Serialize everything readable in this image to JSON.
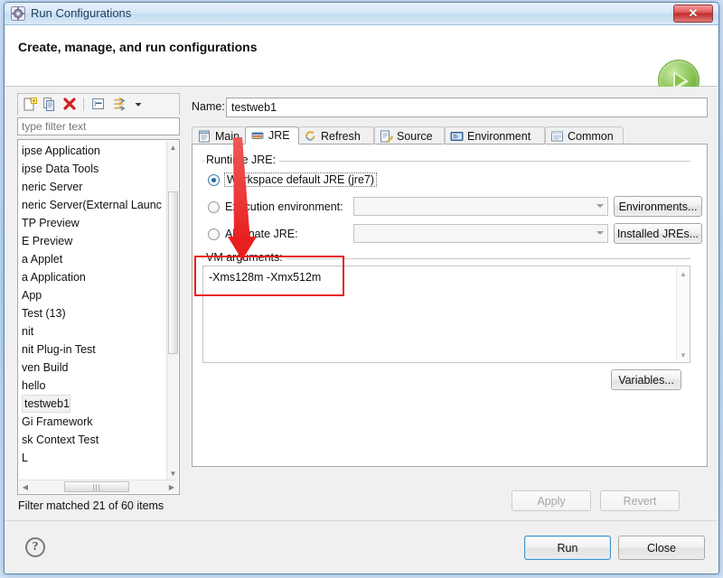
{
  "window": {
    "title": "Run Configurations",
    "title_icon": "run-configurations-icon",
    "close_label": "✕"
  },
  "header": {
    "title": "Create, manage, and run configurations",
    "badge_icon": "run-play-icon"
  },
  "sidebar": {
    "toolbar": [
      {
        "name": "new-configuration-icon",
        "tooltip": "New launch configuration"
      },
      {
        "name": "duplicate-configuration-icon",
        "tooltip": "Duplicate currently selected launch configuration"
      },
      {
        "name": "delete-configuration-icon",
        "tooltip": "Delete selected launch configuration(s)"
      },
      {
        "name": "collapse-all-icon",
        "tooltip": "Collapse All"
      },
      {
        "name": "filter-launch-configurations-icon",
        "tooltip": "Filter launch configurations"
      },
      {
        "name": "view-menu-chevron-icon",
        "tooltip": "View Menu"
      }
    ],
    "filter": {
      "placeholder": "type filter text",
      "value": ""
    },
    "items": [
      {
        "label": "ipse Application",
        "selected": false
      },
      {
        "label": "ipse Data Tools",
        "selected": false
      },
      {
        "label": "neric Server",
        "selected": false
      },
      {
        "label": "neric Server(External Launc",
        "selected": false
      },
      {
        "label": "TP Preview",
        "selected": false
      },
      {
        "label": "E Preview",
        "selected": false
      },
      {
        "label": "a Applet",
        "selected": false
      },
      {
        "label": "a Application",
        "selected": false
      },
      {
        "label": "App",
        "selected": false
      },
      {
        "label": "Test (13)",
        "selected": false
      },
      {
        "label": "nit",
        "selected": false
      },
      {
        "label": "nit Plug-in Test",
        "selected": false
      },
      {
        "label": "ven Build",
        "selected": false
      },
      {
        "label": "hello",
        "selected": false
      },
      {
        "label": "testweb1",
        "selected": true
      },
      {
        "label": "Gi Framework",
        "selected": false
      },
      {
        "label": "sk Context Test",
        "selected": false
      },
      {
        "label": "L",
        "selected": false
      }
    ],
    "status": "Filter matched 21 of 60 items",
    "hscroll_grip": "|||"
  },
  "main": {
    "name_label": "Name:",
    "name_value": "testweb1",
    "tabs": [
      {
        "label": "Main",
        "icon": "main-tab-icon",
        "active": false
      },
      {
        "label": "JRE",
        "icon": "jre-tab-icon",
        "active": true
      },
      {
        "label": "Refresh",
        "icon": "refresh-tab-icon",
        "active": false
      },
      {
        "label": "Source",
        "icon": "source-tab-icon",
        "active": false
      },
      {
        "label": "Environment",
        "icon": "environment-tab-icon",
        "active": false
      },
      {
        "label": "Common",
        "icon": "common-tab-icon",
        "active": false
      }
    ],
    "runtime_jre": {
      "group_title": "Runtime JRE:",
      "options": [
        {
          "label": "Workspace default JRE (jre7)",
          "selected": true,
          "focused": true
        },
        {
          "label": "Execution environment:",
          "selected": false,
          "focused": false
        },
        {
          "label": "Alternate JRE:",
          "selected": false,
          "focused": false
        }
      ],
      "execution_environment_value": "",
      "alternate_jre_value": "",
      "environments_button": "Environments...",
      "installed_jres_button": "Installed JREs..."
    },
    "vm_arguments": {
      "label": "VM arguments:",
      "value": "-Xms128m -Xmx512m",
      "variables_button": "Variables..."
    },
    "apply_button": "Apply",
    "revert_button": "Revert"
  },
  "footer": {
    "help_icon": "help-question-icon",
    "help_glyph": "?",
    "run_button": "Run",
    "close_button": "Close"
  },
  "annotations": {
    "arrow_color": "#e81f1f",
    "rect_color": "#e81f1f",
    "arrow_target": "vm-arguments-field",
    "rect_target": "vm-arguments-group"
  }
}
